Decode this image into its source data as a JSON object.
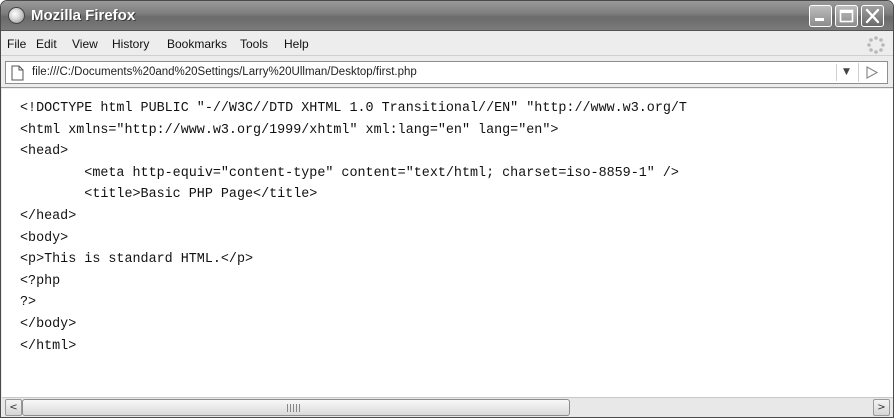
{
  "window": {
    "title": "Mozilla Firefox"
  },
  "menu": {
    "items": [
      "File",
      "Edit",
      "View",
      "History",
      "Bookmarks",
      "Tools",
      "Help"
    ]
  },
  "address_bar": {
    "url": "file:///C:/Documents%20and%20Settings/Larry%20Ullman/Desktop/first.php"
  },
  "page": {
    "source_lines": [
      "<!DOCTYPE html PUBLIC \"-//W3C//DTD XHTML 1.0 Transitional//EN\" \"http://www.w3.org/T",
      "<html xmlns=\"http://www.w3.org/1999/xhtml\" xml:lang=\"en\" lang=\"en\">",
      "<head>",
      "        <meta http-equiv=\"content-type\" content=\"text/html; charset=iso-8859-1\" />",
      "        <title>Basic PHP Page</title>",
      "</head>",
      "<body>",
      "<p>This is standard HTML.</p>",
      "<?php",
      "?>",
      "</body>",
      "</html>"
    ]
  },
  "scrollbar": {
    "left_arrow": "<",
    "right_arrow": ">"
  },
  "icons": {
    "app": "firefox-icon",
    "minimize": "minimize-icon",
    "maximize": "maximize-icon",
    "close": "close-icon",
    "throbber": "throbber-icon",
    "page": "page-icon",
    "dropdown": "dropdown-icon",
    "go": "go-arrow-icon"
  }
}
